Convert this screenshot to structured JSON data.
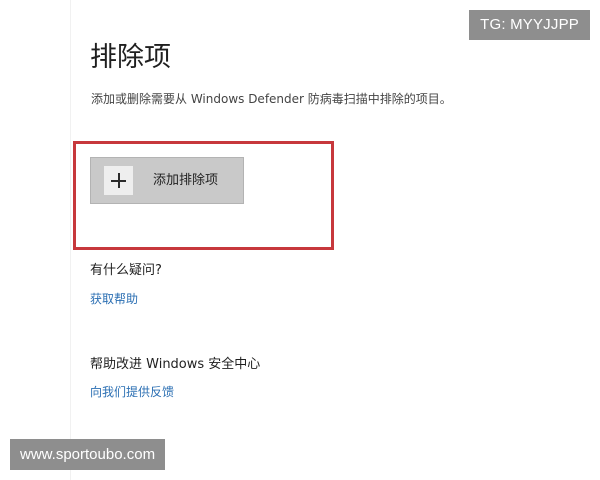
{
  "overlay": {
    "tg_badge": "TG: MYYJJPP",
    "watermark": "www.sportoubo.com"
  },
  "exclusions": {
    "title": "排除项",
    "description": "添加或删除需要从 Windows Defender 防病毒扫描中排除的项目。",
    "add_button_label": "添加排除项",
    "add_button_icon": "plus-icon"
  },
  "help": {
    "question": "有什么疑问?",
    "link": "获取帮助"
  },
  "improve": {
    "title": "帮助改进 Windows 安全中心",
    "link": "向我们提供反馈"
  },
  "colors": {
    "highlight_border": "#c7383c",
    "link": "#2b6fb3",
    "button_bg": "#c9c9c9",
    "badge_bg": "#8e8e8e"
  }
}
